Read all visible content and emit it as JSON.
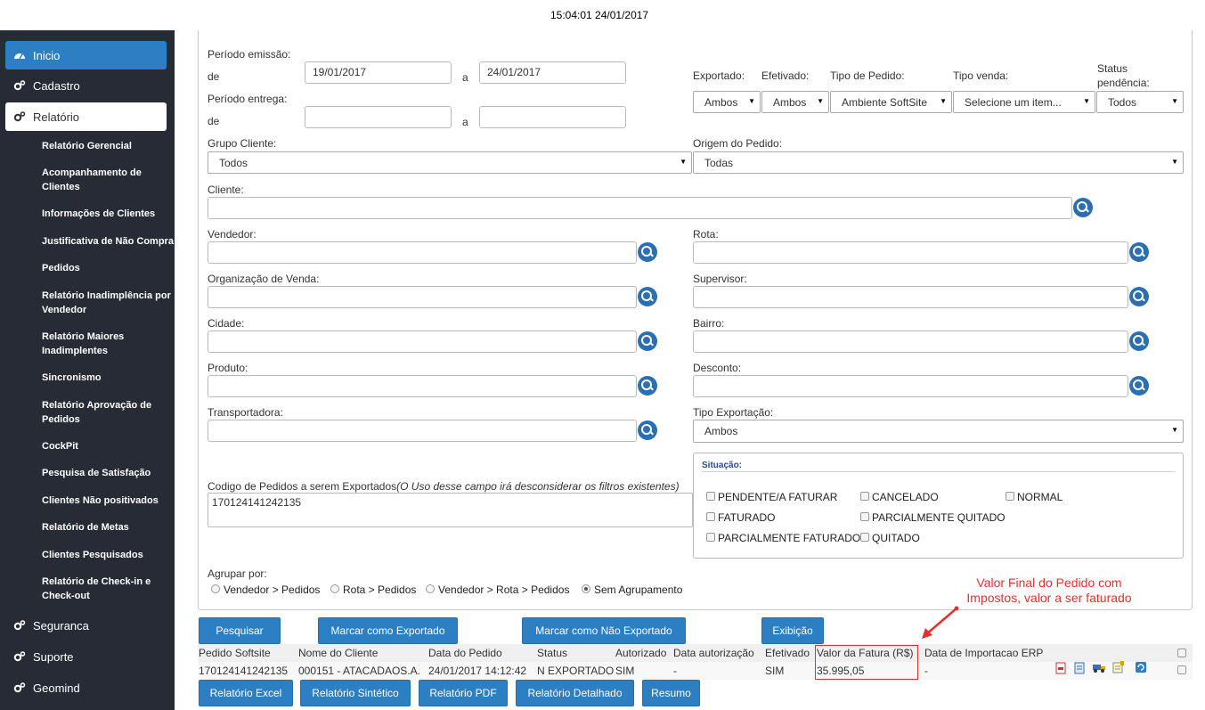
{
  "clock": "15:04:01 24/01/2017",
  "sidebar": {
    "items": [
      {
        "label": "Inicio"
      },
      {
        "label": "Cadastro"
      },
      {
        "label": "Relatório"
      },
      {
        "label": "Seguranca"
      },
      {
        "label": "Suporte"
      },
      {
        "label": "Geomind"
      }
    ],
    "sub": [
      "Relatório Gerencial",
      "Acompanhamento de Clientes",
      "Informações de Clientes",
      "Justificativa de Não Compra",
      "Pedidos",
      "Relatório Inadimplência por Vendedor",
      "Relatório Maiores Inadimplentes",
      "Sincronismo",
      "Relatório Aprovação de Pedidos",
      "CockPit",
      "Pesquisa de Satisfação",
      "Clientes Não positivados",
      "Relatório de Metas",
      "Clientes Pesquisados",
      "Relatório de Check-in e Check-out"
    ]
  },
  "form": {
    "periodo_emissao": "Período emissão:",
    "de": "de",
    "a": "a",
    "emissao_de": "19/01/2017",
    "emissao_ate": "24/01/2017",
    "periodo_entrega": "Período entrega:",
    "exportado": "Exportado:",
    "efetivado": "Efetivado:",
    "tipo_pedido": "Tipo de Pedido:",
    "tipo_venda": "Tipo venda:",
    "status_pendencia_1": "Status",
    "status_pendencia_2": "pendência:",
    "exportado_val": "Ambos",
    "efetivado_val": "Ambos",
    "tipo_pedido_val": "Ambiente SoftSite",
    "tipo_venda_val": "Selecione um item...",
    "status_val": "Todos",
    "grupo_cliente": "Grupo Cliente:",
    "grupo_cliente_val": "Todos",
    "origem_pedido": "Origem do Pedido:",
    "origem_pedido_val": "Todas",
    "cliente": "Cliente:",
    "vendedor": "Vendedor:",
    "rota": "Rota:",
    "org_venda": "Organização de Venda:",
    "supervisor": "Supervisor:",
    "cidade": "Cidade:",
    "bairro": "Bairro:",
    "produto": "Produto:",
    "desconto": "Desconto:",
    "transportadora": "Transportadora:",
    "tipo_exportacao": "Tipo Exportação:",
    "tipo_exportacao_val": "Ambos",
    "codigo_label": "Codigo de Pedidos a serem Exportados",
    "codigo_note": "(O Uso desse campo irá desconsiderar os filtros existentes)",
    "codigo_val": "170124141242135",
    "situacao": "Situação:",
    "situacoes": [
      "PENDENTE/A FATURAR",
      "CANCELADO",
      "NORMAL",
      "FATURADO",
      "PARCIALMENTE QUITADO",
      "PARCIALMENTE FATURADO",
      "QUITADO"
    ],
    "agrupar": "Agrupar por:",
    "agrupamentos": [
      "Vendedor > Pedidos",
      "Rota > Pedidos",
      "Vendedor > Rota > Pedidos",
      "Sem Agrupamento"
    ]
  },
  "buttons": {
    "pesquisar": "Pesquisar",
    "marcar_exportado": "Marcar como Exportado",
    "marcar_nao_exportado": "Marcar como Não Exportado",
    "exibicao": "Exibição",
    "excel": "Relatório Excel",
    "sintetico": "Relatório Sintético",
    "pdf": "Relatório PDF",
    "detalhado": "Relatório Detalhado",
    "resumo": "Resumo"
  },
  "annotation": "Valor Final do Pedido com Impostos, valor a ser faturado",
  "table": {
    "headers": [
      "Pedido Softsite",
      "Nome do Cliente",
      "Data do Pedido",
      "Status",
      "Autorizado",
      "Data autorização",
      "Efetivado",
      "Valor da Fatura (R$)",
      "Data de Importacao ERP"
    ],
    "row": [
      "170124141242135",
      "000151 - ATACADAOS.A.",
      "24/01/2017 14:12:42",
      "N EXPORTADO",
      "SIM",
      "-",
      "SIM",
      "35.995,05",
      "-"
    ]
  },
  "icons": [
    "pdf-icon",
    "report-icon",
    "truck-icon",
    "note-icon",
    "refresh-icon"
  ],
  "colors": {
    "accent": "#2c7fc2",
    "sidebar": "#262b35",
    "annotation": "#e53030"
  }
}
